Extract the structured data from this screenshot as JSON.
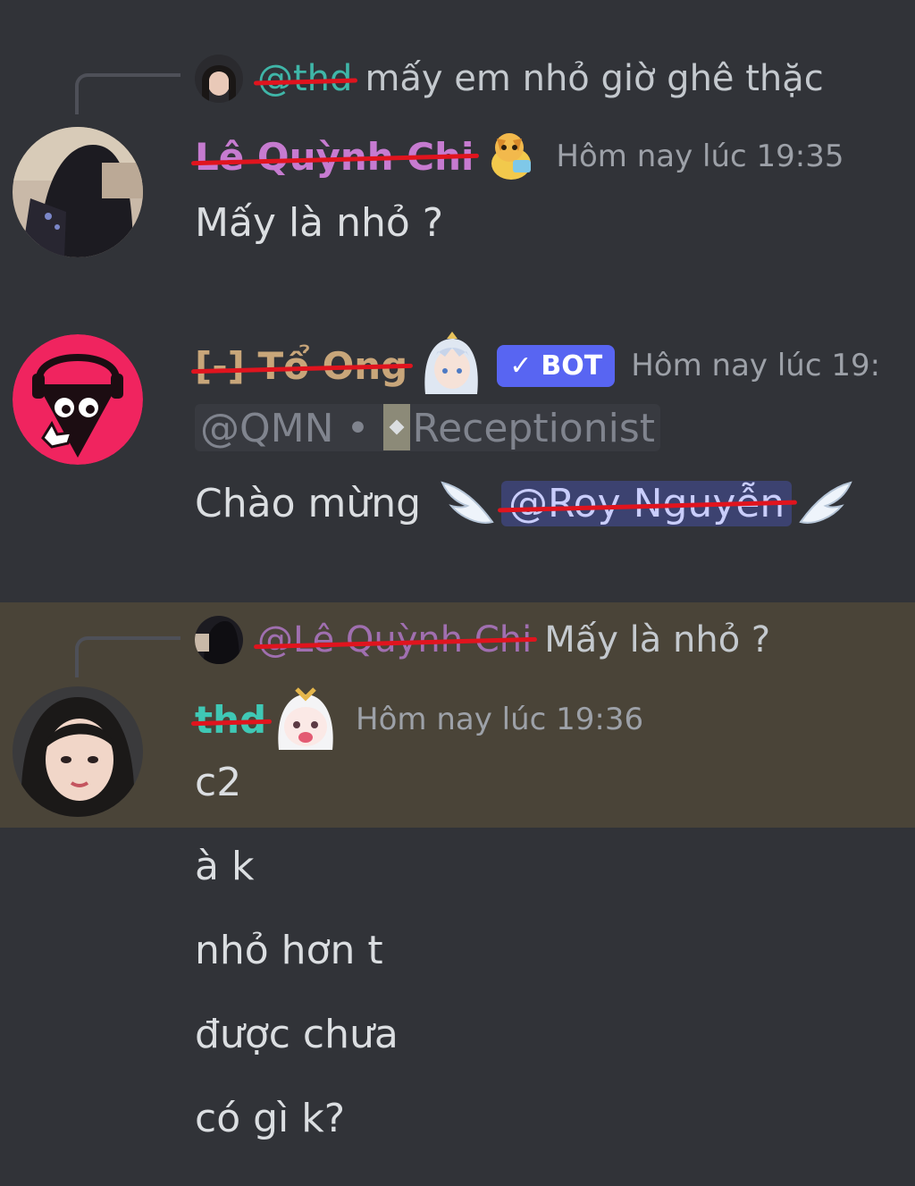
{
  "messages": [
    {
      "reply": {
        "mention": "@thd",
        "text": "mấy em nhỏ giờ ghê thặc"
      },
      "username": "Lê Quỳnh Chi",
      "timestamp": "Hôm nay lúc 19:35",
      "lines": [
        "Mấy là nhỏ ?"
      ],
      "colors": {
        "username": "#c67bd0",
        "reply_mention": "#3fb6a8"
      }
    },
    {
      "username": "[-] Tổ Ong",
      "bot_badge": "BOT",
      "timestamp": "Hôm nay lúc 19:",
      "role_line": {
        "handle": "@QMN",
        "separator": "•",
        "role": "Receptionist"
      },
      "welcome_text": "Chào mừng",
      "welcome_mention": "@Roy Nguyễn",
      "colors": {
        "username": "#c8a67a",
        "bot_badge": "#5865f2"
      }
    },
    {
      "reply": {
        "mention": "@Lê Quỳnh Chi",
        "text": "Mấy là nhỏ ?"
      },
      "username": "thd",
      "timestamp": "Hôm nay lúc 19:36",
      "lines": [
        "c2",
        "à k",
        "nhỏ hơn t",
        "được chưa",
        "có gì k?"
      ],
      "highlighted": true,
      "colors": {
        "username": "#3fc8b5",
        "reply_mention": "#a06fb0",
        "highlight": "#4a4438"
      }
    }
  ],
  "icons": [
    "reply-avatar-icon",
    "dog-emoji-icon",
    "bot-avatar-icon",
    "anime-girl-icon",
    "verified-check-icon",
    "angel-wing-icon",
    "chibi-icon"
  ]
}
